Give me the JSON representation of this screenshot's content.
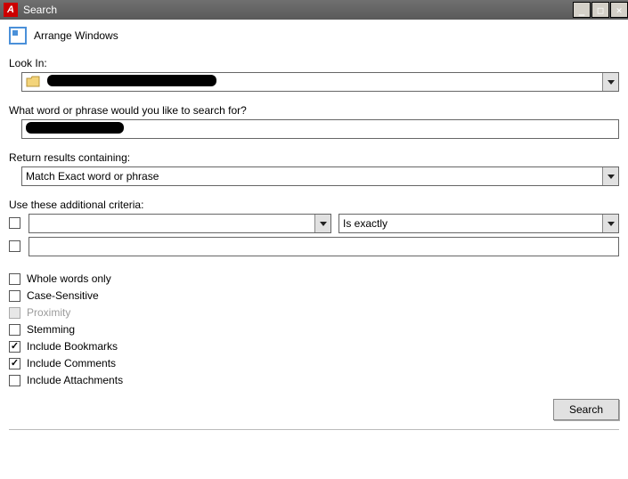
{
  "window": {
    "title": "Search"
  },
  "arrange_windows_label": "Arrange Windows",
  "look_in": {
    "label": "Look In:",
    "value": ""
  },
  "search_phrase": {
    "label": "What word or phrase would you like to search for?",
    "value": ""
  },
  "return_results": {
    "label": "Return results containing:",
    "selected": "Match Exact word or phrase"
  },
  "additional_criteria": {
    "label": "Use these additional criteria:",
    "row1": {
      "property": "",
      "operator": "Is exactly"
    },
    "row2": {
      "value": ""
    }
  },
  "options": {
    "whole_words": {
      "label": "Whole words only",
      "checked": false,
      "disabled": false
    },
    "case_sensitive": {
      "label": "Case-Sensitive",
      "checked": false,
      "disabled": false
    },
    "proximity": {
      "label": "Proximity",
      "checked": false,
      "disabled": true
    },
    "stemming": {
      "label": "Stemming",
      "checked": false,
      "disabled": false
    },
    "include_bookmarks": {
      "label": "Include Bookmarks",
      "checked": true,
      "disabled": false
    },
    "include_comments": {
      "label": "Include Comments",
      "checked": true,
      "disabled": false
    },
    "include_attachments": {
      "label": "Include Attachments",
      "checked": false,
      "disabled": false
    }
  },
  "search_button": "Search"
}
